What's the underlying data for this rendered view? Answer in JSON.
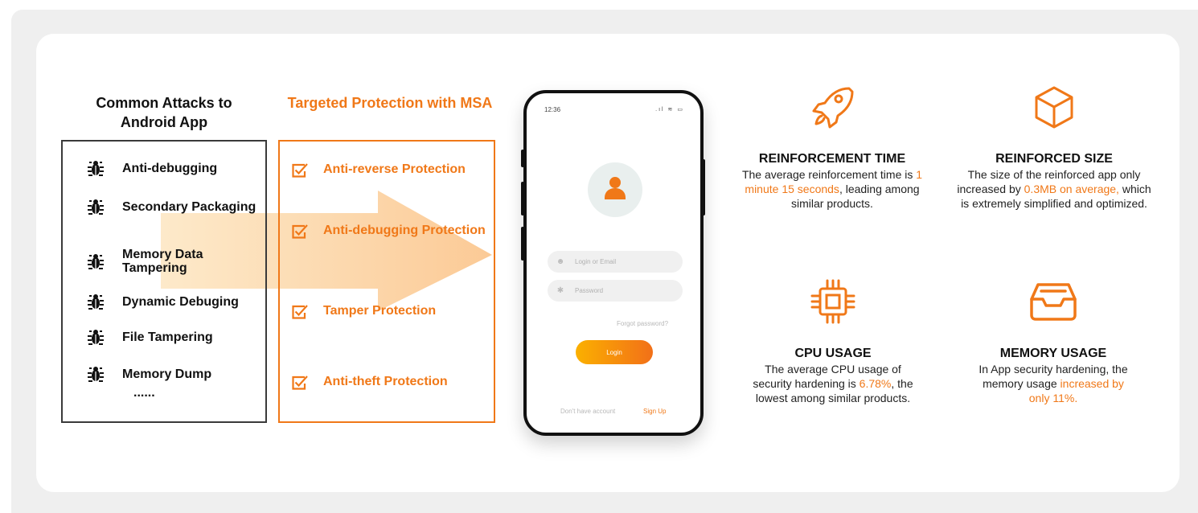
{
  "attacks": {
    "title": "Common Attacks to Android App",
    "items": [
      {
        "label": "Anti-debugging"
      },
      {
        "label": "Secondary Packaging"
      },
      {
        "label": "Memory Data Tampering"
      },
      {
        "label": "Dynamic Debuging"
      },
      {
        "label": "File Tampering"
      },
      {
        "label": "Memory Dump"
      }
    ],
    "more": "......",
    "item_icon": "bug-icon"
  },
  "protection": {
    "title": "Targeted Protection with MSA",
    "items": [
      {
        "label": "Anti-reverse Protection"
      },
      {
        "label": "Anti-debugging Protection"
      },
      {
        "label": "Tamper Protection"
      },
      {
        "label": "Anti-theft Protection"
      }
    ],
    "item_icon": "checkbox-icon"
  },
  "phone": {
    "time": "12:36",
    "status": ".ıl ≋ ▭",
    "login_placeholder": "Login or Email",
    "password_placeholder": "Password",
    "forgot": "Forgot password?",
    "login_button": "Login",
    "no_account": "Don't have account",
    "signup": "Sign Up"
  },
  "metrics": {
    "reinforcement_time": {
      "icon": "rocket-icon",
      "title": "REINFORCEMENT TIME",
      "text_1": "The average reinforcement time is ",
      "highlight": "1 minute 15 seconds",
      "text_2": ", leading among similar products."
    },
    "reinforced_size": {
      "icon": "cube-icon",
      "title": "REINFORCED SIZE",
      "text_1": "The size of the reinforced app only increased by ",
      "highlight": "0.3MB on average,",
      "text_2": " which is extremely simplified and optimized."
    },
    "cpu_usage": {
      "icon": "cpu-chip-icon",
      "title": "CPU USAGE",
      "text_1": "The average CPU usage of security hardening is ",
      "highlight": "6.78%",
      "text_2": ", the lowest among similar products."
    },
    "memory_usage": {
      "icon": "inbox-tray-icon",
      "title": "MEMORY USAGE",
      "text_1": "In App security hardening, the memory usage ",
      "highlight": "increased by only 11%."
    }
  },
  "colors": {
    "accent": "#f07818",
    "dark": "#111111",
    "background": "#efefef"
  }
}
